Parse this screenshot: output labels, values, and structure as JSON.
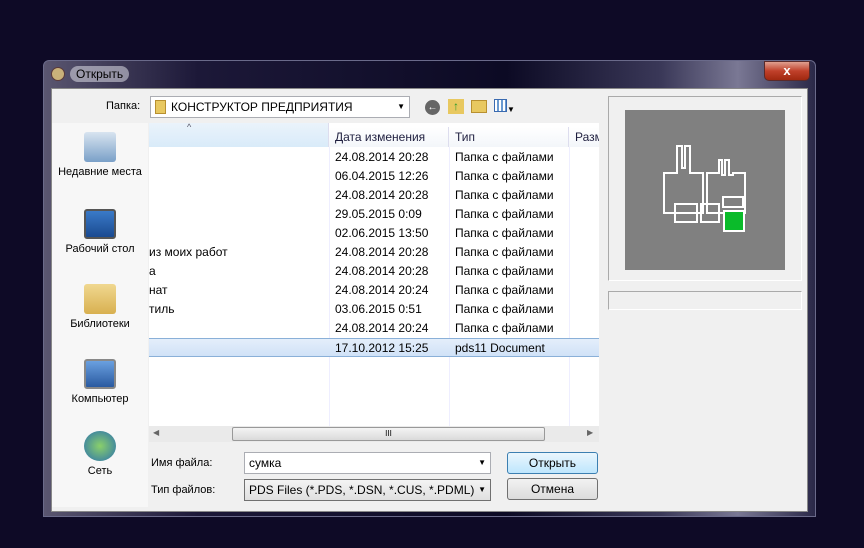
{
  "window": {
    "title": "Открыть",
    "close_label": "x"
  },
  "toolbar": {
    "folder_label": "Папка:",
    "folder_value": "КОНСТРУКТОР ПРЕДПРИЯТИЯ"
  },
  "sidebar": {
    "items": [
      {
        "label": "Недавние места"
      },
      {
        "label": "Рабочий стол"
      },
      {
        "label": "Библиотеки"
      },
      {
        "label": "Компьютер"
      },
      {
        "label": "Сеть"
      }
    ]
  },
  "columns": [
    "",
    "Дата изменения",
    "Тип",
    "Разм"
  ],
  "files": [
    {
      "name": "",
      "date": "24.08.2014 20:28",
      "type": "Папка с файлами"
    },
    {
      "name": "",
      "date": "06.04.2015 12:26",
      "type": "Папка с файлами"
    },
    {
      "name": "",
      "date": "24.08.2014 20:28",
      "type": "Папка с файлами"
    },
    {
      "name": "",
      "date": "29.05.2015 0:09",
      "type": "Папка с файлами"
    },
    {
      "name": "",
      "date": "02.06.2015 13:50",
      "type": "Папка с файлами"
    },
    {
      "name": "из моих работ",
      "date": "24.08.2014 20:28",
      "type": "Папка с файлами"
    },
    {
      "name": "а",
      "date": "24.08.2014 20:28",
      "type": "Папка с файлами"
    },
    {
      "name": "нат",
      "date": "24.08.2014 20:24",
      "type": "Папка с файлами"
    },
    {
      "name": "тиль",
      "date": "03.06.2015 0:51",
      "type": "Папка с файлами"
    },
    {
      "name": "",
      "date": "24.08.2014 20:24",
      "type": "Папка с файлами"
    },
    {
      "name": "",
      "date": "17.10.2012 15:25",
      "type": "pds11 Document",
      "selected": true
    }
  ],
  "form": {
    "filename_label": "Имя файла:",
    "filename_value": "сумка",
    "filetype_label": "Тип файлов:",
    "filetype_value": "PDS Files (*.PDS, *.DSN, *.CUS, *.PDML)",
    "open_label": "Открыть",
    "cancel_label": "Отмена"
  },
  "scrollbar": {
    "thumb_grip": "III"
  }
}
